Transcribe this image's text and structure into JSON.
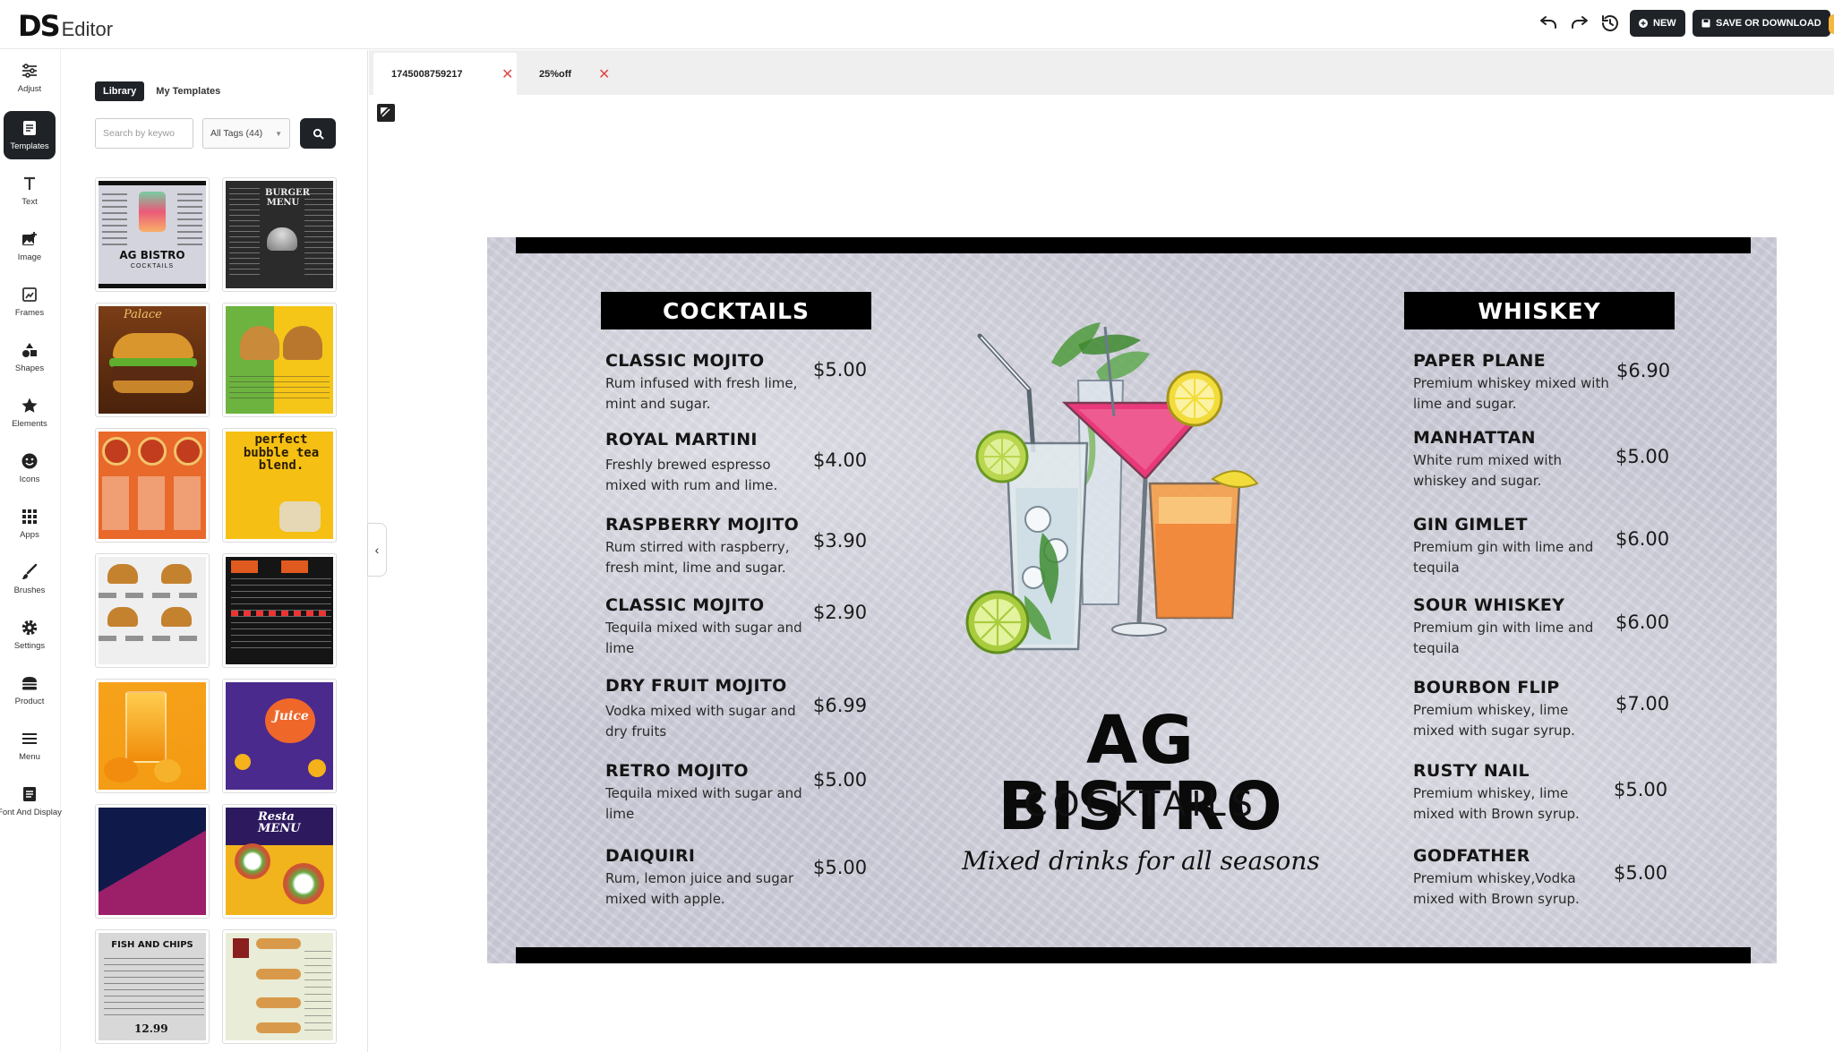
{
  "app": {
    "logo_bold": "DS",
    "logo_rest": "Editor"
  },
  "toolbar": {
    "new_label": "NEW",
    "save_label": "SAVE OR DOWNLOAD"
  },
  "nav": {
    "items": [
      {
        "label": "Adjust",
        "icon": "sliders-icon"
      },
      {
        "label": "Templates",
        "icon": "template-icon"
      },
      {
        "label": "Text",
        "icon": "text-icon"
      },
      {
        "label": "Image",
        "icon": "image-icon"
      },
      {
        "label": "Frames",
        "icon": "frame-icon"
      },
      {
        "label": "Shapes",
        "icon": "shapes-icon"
      },
      {
        "label": "Elements",
        "icon": "star-icon"
      },
      {
        "label": "Icons",
        "icon": "smiley-icon"
      },
      {
        "label": "Apps",
        "icon": "grid-icon"
      },
      {
        "label": "Brushes",
        "icon": "brush-icon"
      },
      {
        "label": "Settings",
        "icon": "gear-icon"
      },
      {
        "label": "Product",
        "icon": "burger-icon"
      },
      {
        "label": "Menu",
        "icon": "menu-icon"
      },
      {
        "label": "Font And Display",
        "icon": "document-icon"
      }
    ]
  },
  "panel": {
    "tab_library": "Library",
    "tab_my_templates": "My Templates",
    "search_placeholder": "Search by keywo",
    "tags_select": "All Tags (44)",
    "thumbnails": {
      "t1_title": "AG BISTRO",
      "t1_sub": "COCKTAILS",
      "t2_title": "BURGER MENU",
      "t3_title": "Palace",
      "t6_title": "perfect bubble tea blend.",
      "t10_title": "Juice",
      "t12_title": "Resta MENU",
      "t13_title": "FISH AND CHIPS",
      "t13_price": "12.99"
    }
  },
  "doc_tabs": [
    {
      "label": "1745008759217",
      "active": true
    },
    {
      "label": "25%off",
      "active": false
    }
  ],
  "menu": {
    "left_heading": "COCKTAILS",
    "right_heading": "WHISKEY",
    "brand": "AG BISTRO",
    "brand_sub": "COCKTAILS",
    "tagline": "Mixed drinks for all seasons",
    "cocktails": [
      {
        "name": "CLASSIC MOJITO",
        "desc": "Rum infused with fresh lime, mint and sugar.",
        "price": "$5.00"
      },
      {
        "name": "ROYAL MARTINI",
        "desc": "Freshly brewed espresso mixed with rum and lime.",
        "price": "$4.00"
      },
      {
        "name": "RASPBERRY MOJITO",
        "desc": "Rum stirred with raspberry, fresh mint, lime and sugar.",
        "price": "$3.90"
      },
      {
        "name": "CLASSIC MOJITO",
        "desc": "Tequila mixed with sugar and lime",
        "price": "$2.90"
      },
      {
        "name": "DRY FRUIT MOJITO",
        "desc": "Vodka mixed with sugar and dry fruits",
        "price": "$6.99"
      },
      {
        "name": "RETRO MOJITO",
        "desc": "Tequila mixed with sugar and lime",
        "price": "$5.00"
      },
      {
        "name": "DAIQUIRI",
        "desc": "Rum, lemon juice and sugar mixed with apple.",
        "price": "$5.00"
      }
    ],
    "whiskey": [
      {
        "name": "PAPER PLANE",
        "desc": "Premium whiskey mixed with lime and sugar.",
        "price": "$6.90"
      },
      {
        "name": "MANHATTAN",
        "desc": "White rum mixed with whiskey and sugar.",
        "price": "$5.00"
      },
      {
        "name": "GIN GIMLET",
        "desc": "Premium gin with lime and tequila",
        "price": "$6.00"
      },
      {
        "name": "SOUR WHISKEY",
        "desc": "Premium gin with lime and tequila",
        "price": "$6.00"
      },
      {
        "name": "BOURBON FLIP",
        "desc": "Premium whiskey, lime mixed with sugar syrup.",
        "price": "$7.00"
      },
      {
        "name": "RUSTY NAIL",
        "desc": "Premium whiskey, lime mixed with Brown syrup.",
        "price": "$5.00"
      },
      {
        "name": "GODFATHER",
        "desc": "Premium whiskey,Vodka mixed with Brown syrup.",
        "price": "$5.00"
      }
    ]
  },
  "colors": {
    "dark": "#1f2328",
    "close_x": "#e04848",
    "menu_bg": "#cfcfdc"
  }
}
